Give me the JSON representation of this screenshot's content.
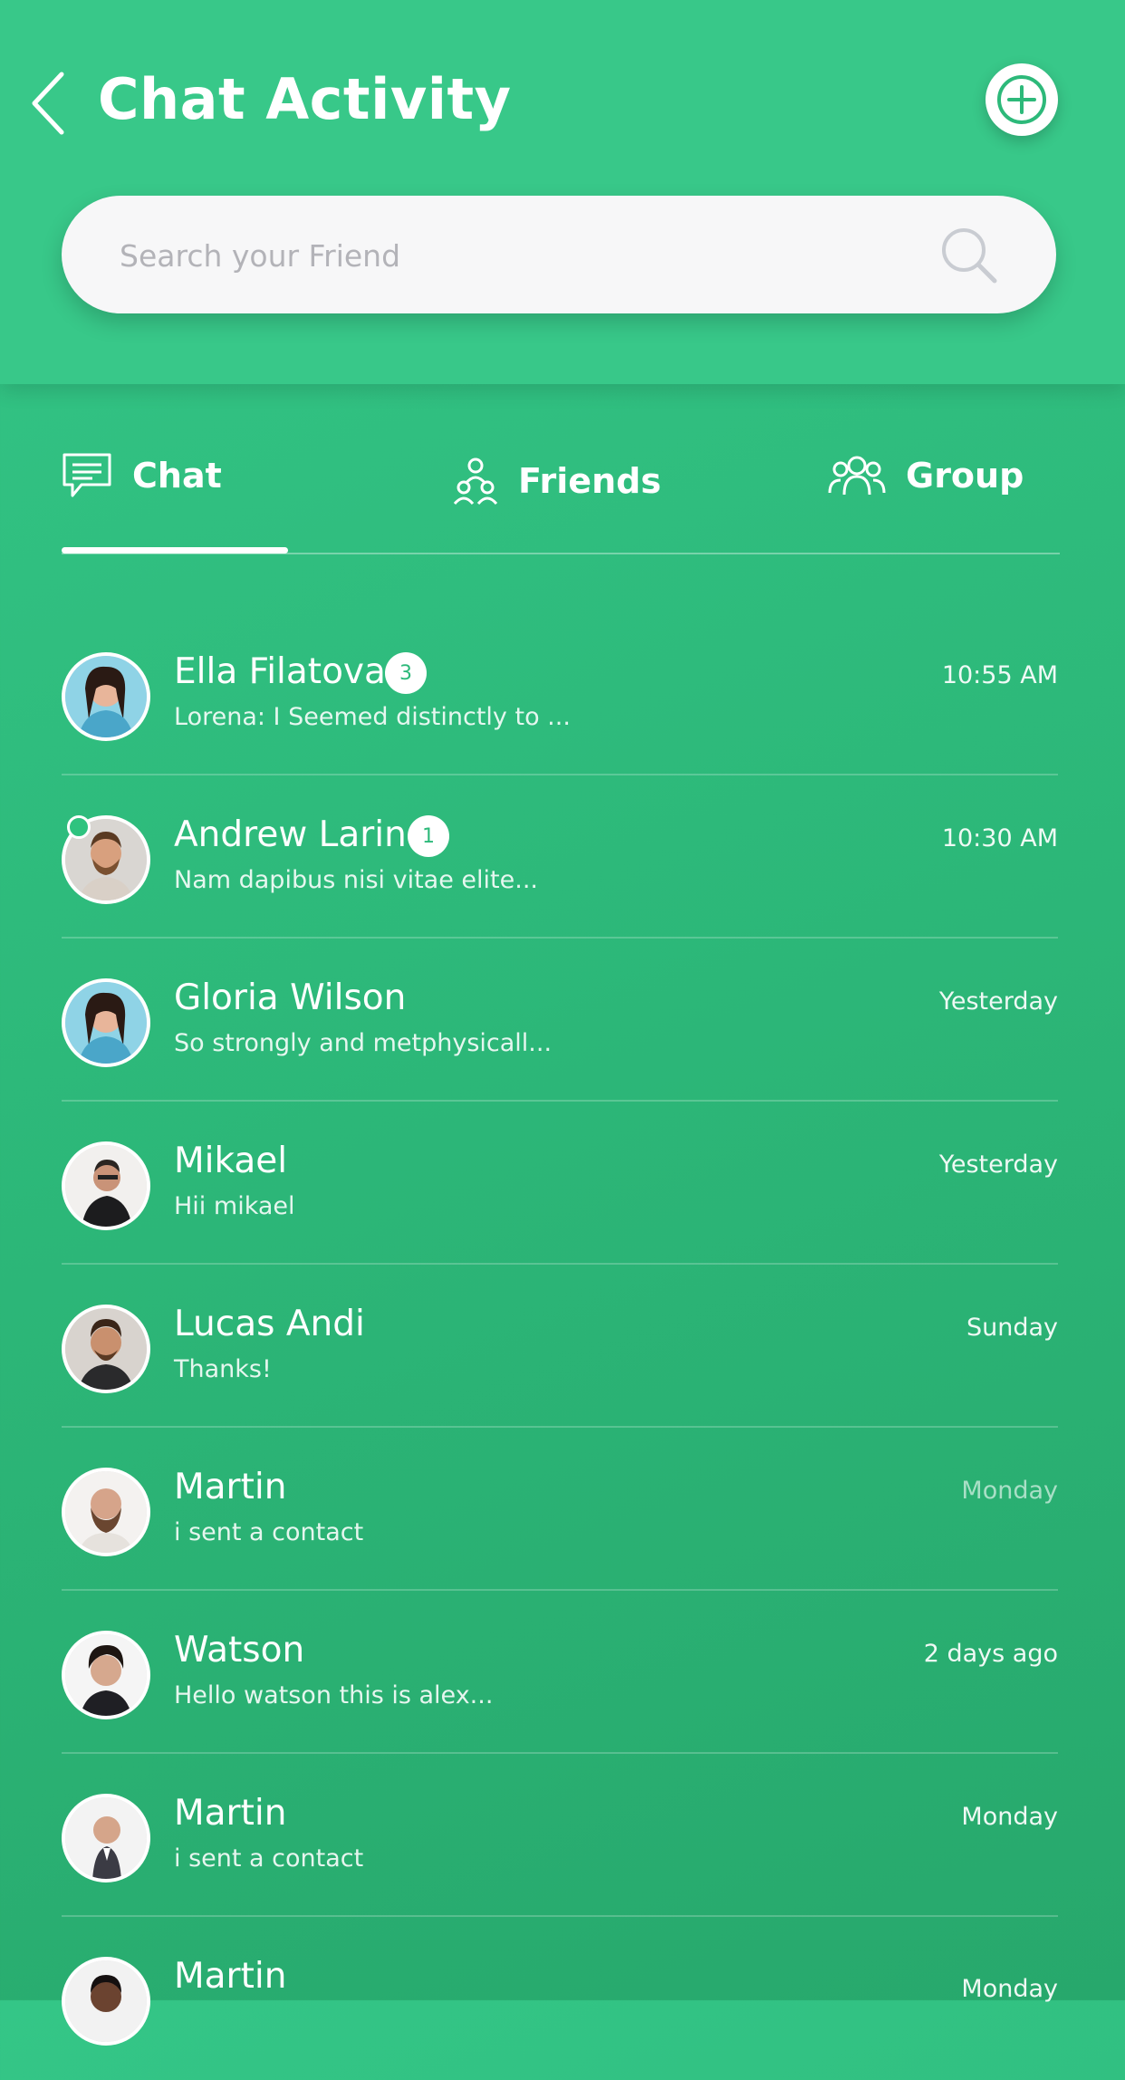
{
  "header": {
    "title": "Chat Activity",
    "search_placeholder": "Search your Friend",
    "icons": {
      "back": "back-arrow-icon",
      "add": "plus-icon",
      "search": "search-icon"
    },
    "colors": {
      "primary": "#38c889",
      "accent": "#2db97a"
    }
  },
  "tabs": [
    {
      "label": "Chat",
      "icon": "chat-bubble-icon",
      "active": true
    },
    {
      "label": "Friends",
      "icon": "friends-icon",
      "active": false
    },
    {
      "label": "Group",
      "icon": "group-icon",
      "active": false
    }
  ],
  "chats": [
    {
      "name": "Ella Filatova",
      "badge": "3",
      "message": "Lorena: I Seemed distinctly to ...",
      "time": "10:55 AM",
      "online": false
    },
    {
      "name": "Andrew Larin",
      "badge": "1",
      "message": "Nam dapibus nisi vitae elite...",
      "time": "10:30 AM",
      "online": true
    },
    {
      "name": "Gloria Wilson",
      "badge": "",
      "message": "So strongly and metphysicall...",
      "time": "Yesterday",
      "online": false
    },
    {
      "name": "Mikael",
      "badge": "",
      "message": "Hii mikael",
      "time": "Yesterday",
      "online": false
    },
    {
      "name": "Lucas Andi",
      "badge": "",
      "message": "Thanks!",
      "time": "Sunday",
      "online": false
    },
    {
      "name": "Martin",
      "badge": "",
      "message": "i sent a contact",
      "time": "Monday",
      "online": false
    },
    {
      "name": "Watson",
      "badge": "",
      "message": "Hello watson this is alex...",
      "time": "2 days ago",
      "online": false
    },
    {
      "name": "Martin",
      "badge": "",
      "message": "i sent a contact",
      "time": "Monday",
      "online": false
    },
    {
      "name": "Martin",
      "badge": "",
      "message": "",
      "time": "Monday",
      "online": false
    }
  ]
}
